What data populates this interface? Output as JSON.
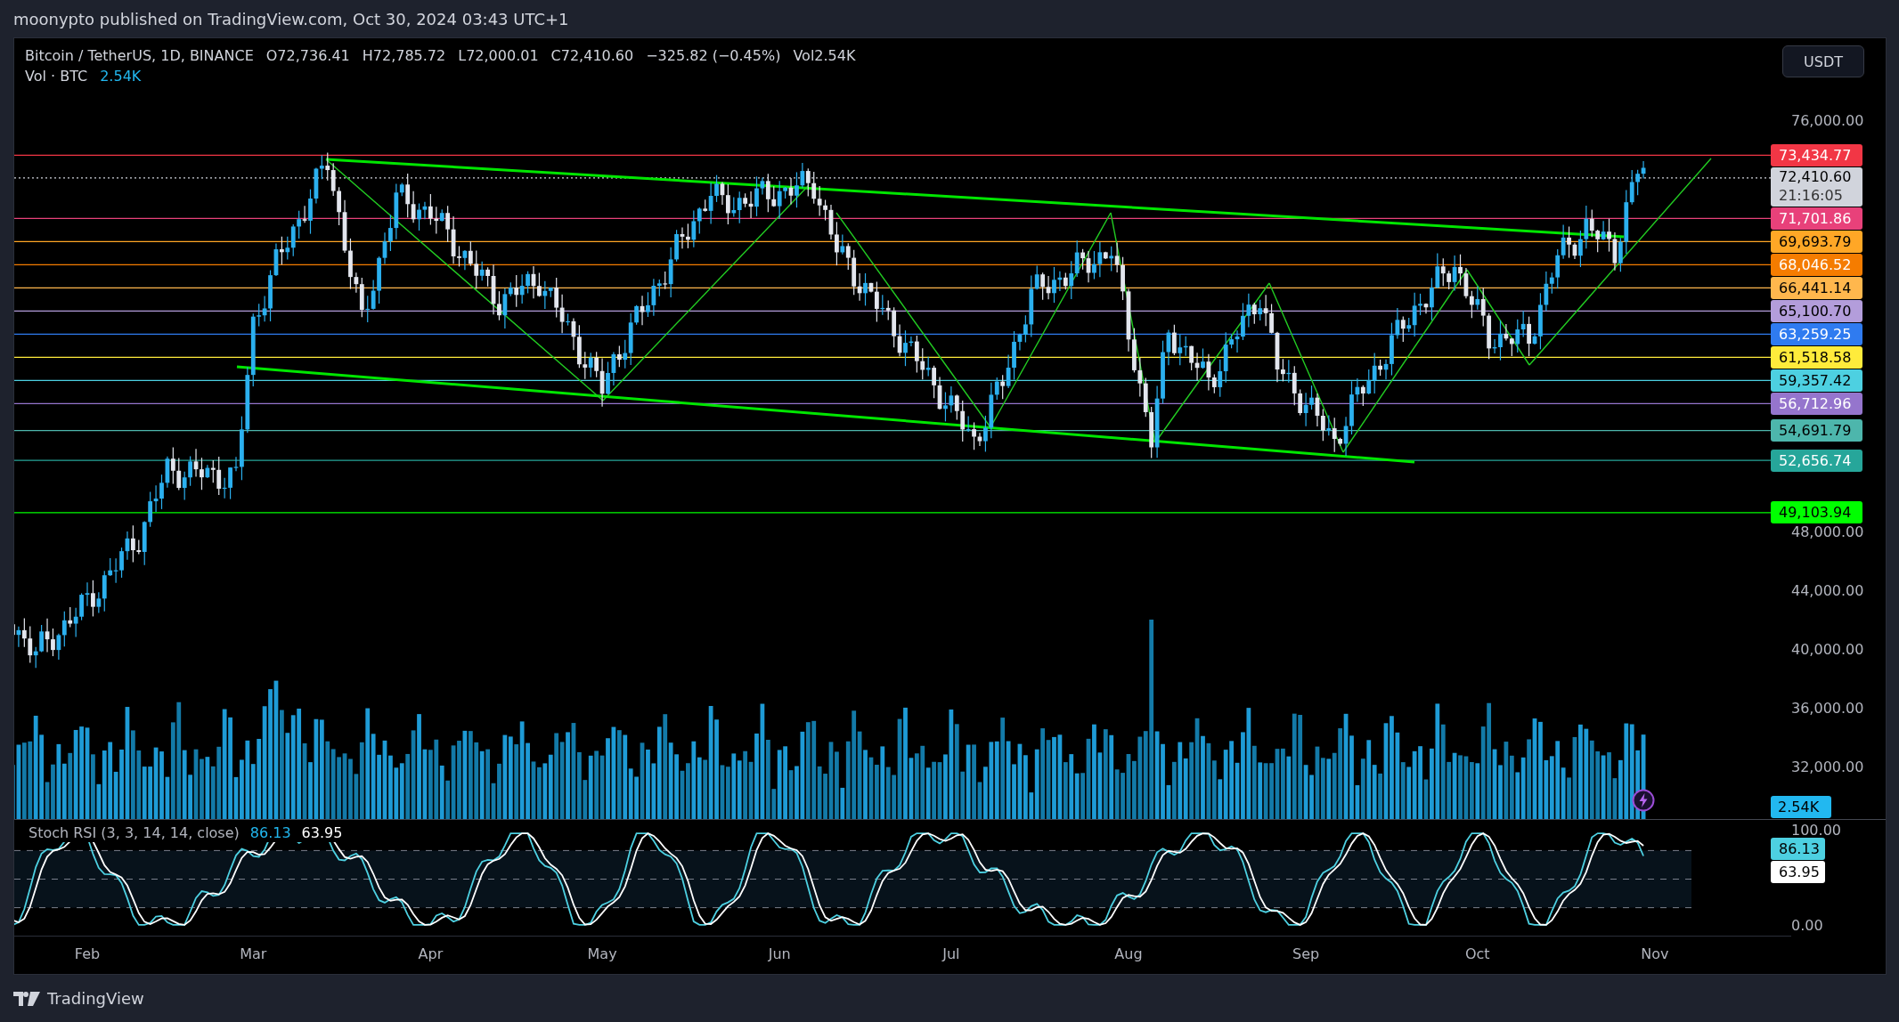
{
  "header": {
    "text": "moonypto published on TradingView.com, Oct 30, 2024 03:43 UTC+1"
  },
  "legend": {
    "symbol": "Bitcoin / TetherUS, 1D, BINANCE",
    "open": "O72,736.41",
    "high": "H72,785.72",
    "low": "L72,000.01",
    "close": "C72,410.60",
    "change": "−325.82 (−0.45%)",
    "volume": "Vol2.54K"
  },
  "volume_legend": {
    "label": "Vol · BTC",
    "value": "2.54K"
  },
  "currency_button": "USDT",
  "price_ticks": [
    "76,000.00",
    "48,000.00",
    "44,000.00",
    "40,000.00",
    "36,000.00",
    "32,000.00"
  ],
  "price_levels": [
    {
      "label": "73,434.77",
      "color": "#f23645"
    },
    {
      "label": "71,701.86",
      "color": "#e8417a"
    },
    {
      "label": "69,693.79",
      "color": "#ffa726"
    },
    {
      "label": "68,046.52",
      "color": "#f57c00"
    },
    {
      "label": "66,441.14",
      "color": "#ffb74d"
    },
    {
      "label": "65,100.70",
      "color": "#b39ddb"
    },
    {
      "label": "63,259.25",
      "color": "#2f7bf0"
    },
    {
      "label": "61,518.58",
      "color": "#ffeb3b"
    },
    {
      "label": "59,357.42",
      "color": "#4dd0e1"
    },
    {
      "label": "56,712.96",
      "color": "#9575cd"
    },
    {
      "label": "54,691.79",
      "color": "#4db6ac"
    },
    {
      "label": "52,656.74",
      "color": "#26a69a"
    },
    {
      "label": "49,103.94",
      "color": "#00ff00"
    }
  ],
  "last_price": {
    "price": "72,410.60",
    "countdown": "21:16:05"
  },
  "volume_badge": "2.54K",
  "rsi": {
    "title": "Stoch RSI (3, 3, 14, 14, close)",
    "k": "86.13",
    "d": "63.95",
    "ticks": [
      "100.00",
      "0.00"
    ],
    "axis_k": "86.13",
    "axis_d": "63.95"
  },
  "time_axis": [
    "Feb",
    "Mar",
    "Apr",
    "May",
    "Jun",
    "Jul",
    "Aug",
    "Sep",
    "Oct",
    "Nov"
  ],
  "footer": {
    "brand": "TradingView"
  }
}
